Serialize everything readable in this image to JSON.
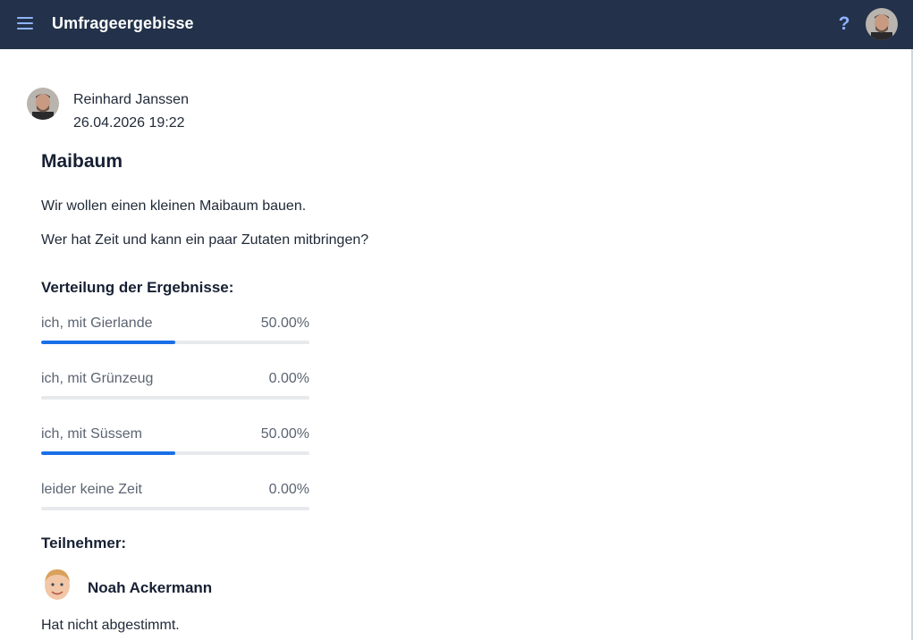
{
  "header": {
    "title": "Umfrageergebisse",
    "menu_icon": "menu-icon",
    "help_label": "?",
    "accent_color": "#8fb3ff",
    "background_color": "#23324a"
  },
  "post": {
    "author_name": "Reinhard Janssen",
    "date": "26.04.2026 19:22",
    "title": "Maibaum",
    "description_1": "Wir wollen einen kleinen Maibaum bauen.",
    "description_2": "Wer hat Zeit und kann ein paar Zutaten mitbringen?"
  },
  "results": {
    "heading": "Verteilung der Ergebnisse:",
    "bar_color": "#1a6fe8",
    "items": [
      {
        "label": "ich, mit Gierlande",
        "percent_text": "50.00%",
        "value": 50
      },
      {
        "label": "ich, mit Grünzeug",
        "percent_text": "0.00%",
        "value": 0
      },
      {
        "label": "ich, mit Süssem",
        "percent_text": "50.00%",
        "value": 50
      },
      {
        "label": "leider keine Zeit",
        "percent_text": "0.00%",
        "value": 0
      }
    ]
  },
  "participants": {
    "heading": "Teilnehmer:",
    "items": [
      {
        "name": "Noah Ackermann",
        "status": "Hat nicht abgestimmt."
      }
    ]
  }
}
